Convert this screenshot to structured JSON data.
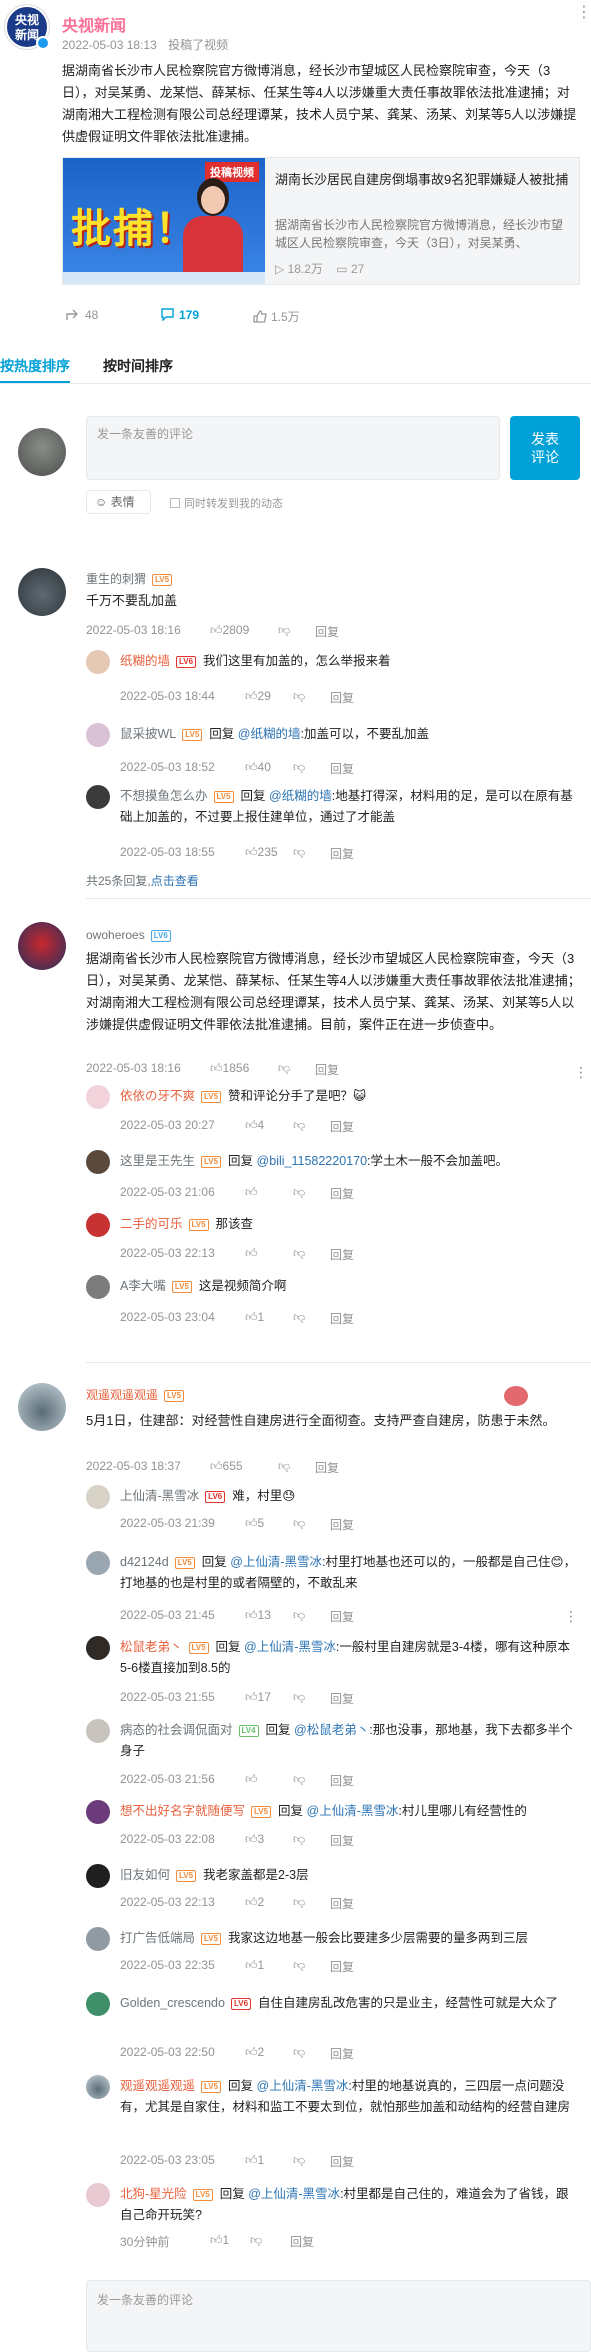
{
  "post": {
    "account": "央视新闻",
    "avatar_text": [
      "央视",
      "新闻"
    ],
    "time": "2022-05-03 18:13",
    "source": "投稿了视频",
    "body": "据湖南省长沙市人民检察院官方微博消息，经长沙市望城区人民检察院审查，今天（3日），对吴某勇、龙某恺、薛某标、任某生等4人以涉嫌重大责任事故罪依法批准逮捕；对湖南湘大工程检测有限公司总经理谭某，技术人员宁某、龚某、汤某、刘某等5人以涉嫌提供虚假证明文件罪依法批准逮捕。",
    "card": {
      "thumb_label": "批捕！",
      "thumb_tag": "投稿视频",
      "title": "湖南长沙居民自建房倒塌事故9名犯罪嫌疑人被批捕",
      "desc": "据湖南省长沙市人民检察院官方微博消息，经长沙市望城区人民检察院审查，今天（3日），对吴某勇、",
      "plays": "18.2万",
      "danmaku": "27"
    },
    "forwards": "48",
    "comments": "179",
    "likes": "1.5万"
  },
  "tabs": {
    "hot": "按热度排序",
    "time": "按时间排序"
  },
  "composer": {
    "placeholder": "发一条友善的评论",
    "submit": "发表评论",
    "emoji": "表情",
    "sync": "同时转发到我的动态"
  },
  "comments": [
    {
      "user": "重生的刺猬",
      "level": "LV5",
      "text": "千万不要乱加盖",
      "time": "2022-05-03 18:16",
      "likes": "2809",
      "reply": "回复",
      "replies": [
        {
          "user": "纸糊的墙",
          "level": "LV6",
          "text": "我们这里有加盖的，怎么举报来着",
          "time": "2022-05-03 18:44",
          "likes": "29"
        },
        {
          "user": "鼠采披WL",
          "level": "LV5",
          "prefix": "回复",
          "at": "@纸糊的墙",
          "text": ":加盖可以，不要乱加盖",
          "time": "2022-05-03 18:52",
          "likes": "40"
        },
        {
          "user": "不想摸鱼怎么办",
          "level": "LV5",
          "prefix": "回复",
          "at": "@纸糊的墙",
          "text": ":地基打得深，材料用的足，是可以在原有基础上加盖的，不过要上报住建单位，通过了才能盖",
          "time": "2022-05-03 18:55",
          "likes": "235"
        }
      ],
      "more": "共25条回复,",
      "more_link": "点击查看"
    },
    {
      "user": "owoheroes",
      "level": "LV6",
      "text": "据湖南省长沙市人民检察院官方微博消息，经长沙市望城区人民检察院审查，今天（3日），对吴某勇、龙某恺、薛某标、任某生等4人以涉嫌重大责任事故罪依法批准逮捕；对湖南湘大工程检测有限公司总经理谭某，技术人员宁某、龚某、汤某、刘某等5人以涉嫌提供虚假证明文件罪依法批准逮捕。目前，案件正在进一步侦查中。",
      "time": "2022-05-03 18:16",
      "likes": "1856",
      "reply": "回复",
      "replies": [
        {
          "user": "依依の牙不爽",
          "level": "LV5",
          "text": "赞和评论分手了是吧？😺",
          "time": "2022-05-03 20:27",
          "likes": "4"
        },
        {
          "user": "这里是王先生",
          "level": "LV5",
          "prefix": "回复",
          "at": "@bili_11582220170",
          "text": ":学土木一般不会加盖吧。",
          "time": "2022-05-03 21:06",
          "likes": ""
        },
        {
          "user": "二手的可乐",
          "level": "LV5",
          "text": "那该查",
          "time": "2022-05-03 22:13",
          "likes": ""
        },
        {
          "user": "A李大嘴",
          "level": "LV5",
          "text": "这是视频简介啊",
          "time": "2022-05-03 23:04",
          "likes": "1"
        }
      ]
    },
    {
      "user": "观遥观遥观遥",
      "level": "LV5",
      "text": "5月1日，住建部：对经营性自建房进行全面彻查。支持严查自建房，防患于未然。",
      "time": "2022-05-03 18:37",
      "likes": "655",
      "reply": "回复",
      "replies": [
        {
          "user": "上仙清-黑雪冰",
          "level": "LV6",
          "text": "难，村里😓",
          "time": "2022-05-03 21:39",
          "likes": "5"
        },
        {
          "user": "d42124d",
          "level": "LV5",
          "prefix": "回复",
          "at": "@上仙清-黑雪冰",
          "text": ":村里打地基也还可以的，一般都是自己住😊，打地基的也是村里的或者隔壁的，不敢乱来",
          "time": "2022-05-03 21:45",
          "likes": "13"
        },
        {
          "user": "松鼠老弟丶",
          "level": "LV5",
          "prefix": "回复",
          "at": "@上仙清-黑雪冰",
          "text": ":一般村里自建房就是3-4楼，哪有这种原本5-6楼直接加到8.5的",
          "time": "2022-05-03 21:55",
          "likes": "17"
        },
        {
          "user": "病态的社会调侃面对",
          "level": "LV4",
          "prefix": "回复",
          "at": "@松鼠老弟丶",
          "text": ":那也没事，那地基，我下去都多半个身子",
          "time": "2022-05-03 21:56",
          "likes": ""
        },
        {
          "user": "想不出好名字就随便写",
          "level": "LV5",
          "prefix": "回复",
          "at": "@上仙清-黑雪冰",
          "text": ":村儿里哪儿有经营性的",
          "time": "2022-05-03 22:08",
          "likes": "3"
        },
        {
          "user": "旧友如何",
          "level": "LV5",
          "text": "我老家盖都是2-3层",
          "time": "2022-05-03 22:13",
          "likes": "2"
        },
        {
          "user": "打广告低端局",
          "level": "LV5",
          "text": "我家这边地基一般会比要建多少层需要的量多两到三层",
          "time": "2022-05-03 22:35",
          "likes": "1"
        },
        {
          "user": "Golden_crescendo",
          "level": "LV6",
          "text": "自住自建房乱改危害的只是业主，经营性可就是大众了",
          "time": "2022-05-03 22:50",
          "likes": "2"
        },
        {
          "user": "观遥观遥观遥",
          "level": "LV5",
          "prefix": "回复",
          "at": "@上仙清-黑雪冰",
          "text": ":村里的地基说真的，三四层一点问题没有，尤其是自家住，材料和监工不要太到位，就怕那些加盖和动结构的经营自建房",
          "time": "2022-05-03 23:05",
          "likes": "1"
        },
        {
          "user": "北狗-星光险",
          "level": "LV5",
          "prefix": "回复",
          "at": "@上仙清-黑雪冰",
          "text": ":村里都是自己住的，难道会为了省钱，跟自己命开玩笑?",
          "time": "30分钟前",
          "likes": "1"
        }
      ]
    }
  ],
  "bottom_placeholder": "发一条友善的评论",
  "colors": {
    "accent": "#00a1d6",
    "username_red": "#fb7299",
    "level_orange": "#f28c3a"
  }
}
